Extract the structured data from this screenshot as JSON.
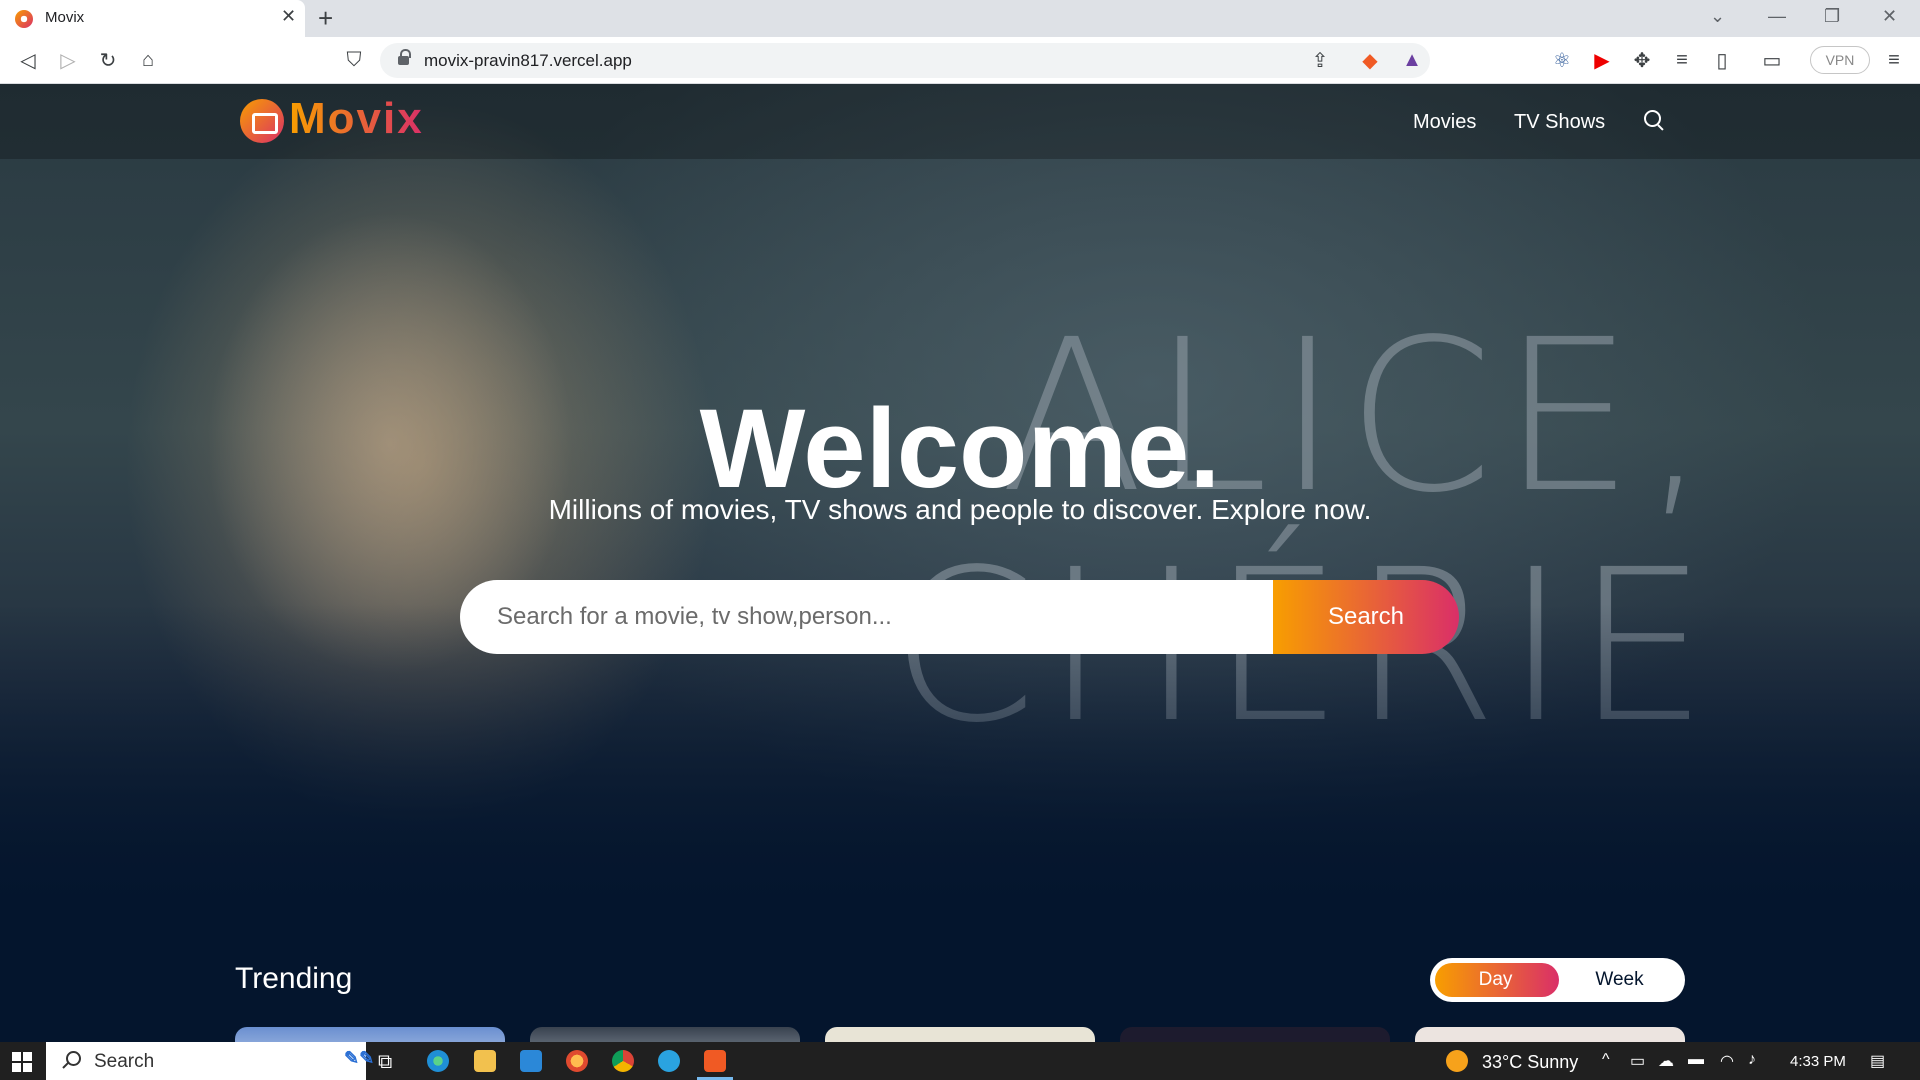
{
  "browser": {
    "tab_title": "Movix",
    "tab_close": "✕",
    "new_tab": "+",
    "url": "movix-pravin817.vercel.app",
    "vpn_label": "VPN"
  },
  "site": {
    "logo_text": "Movix",
    "nav": {
      "movies": "Movies",
      "tv_shows": "TV Shows"
    },
    "hero": {
      "poster_line1": "ALICE,",
      "poster_line2": "CHÉRIE",
      "title": "Welcome.",
      "subtitle": "Millions of movies, TV shows and people to discover. Explore now.",
      "search_placeholder": "Search for a movie, tv show,person...",
      "search_button": "Search"
    },
    "trending": {
      "title": "Trending",
      "options": [
        "Day",
        "Week"
      ],
      "selected": "Day"
    }
  },
  "taskbar": {
    "search_label": "Search",
    "weather": "33°C  Sunny",
    "time": "4:33 PM"
  },
  "colors": {
    "brand_orange": "#f89e00",
    "brand_pink": "#da2f68",
    "page_bg": "#04152d"
  }
}
